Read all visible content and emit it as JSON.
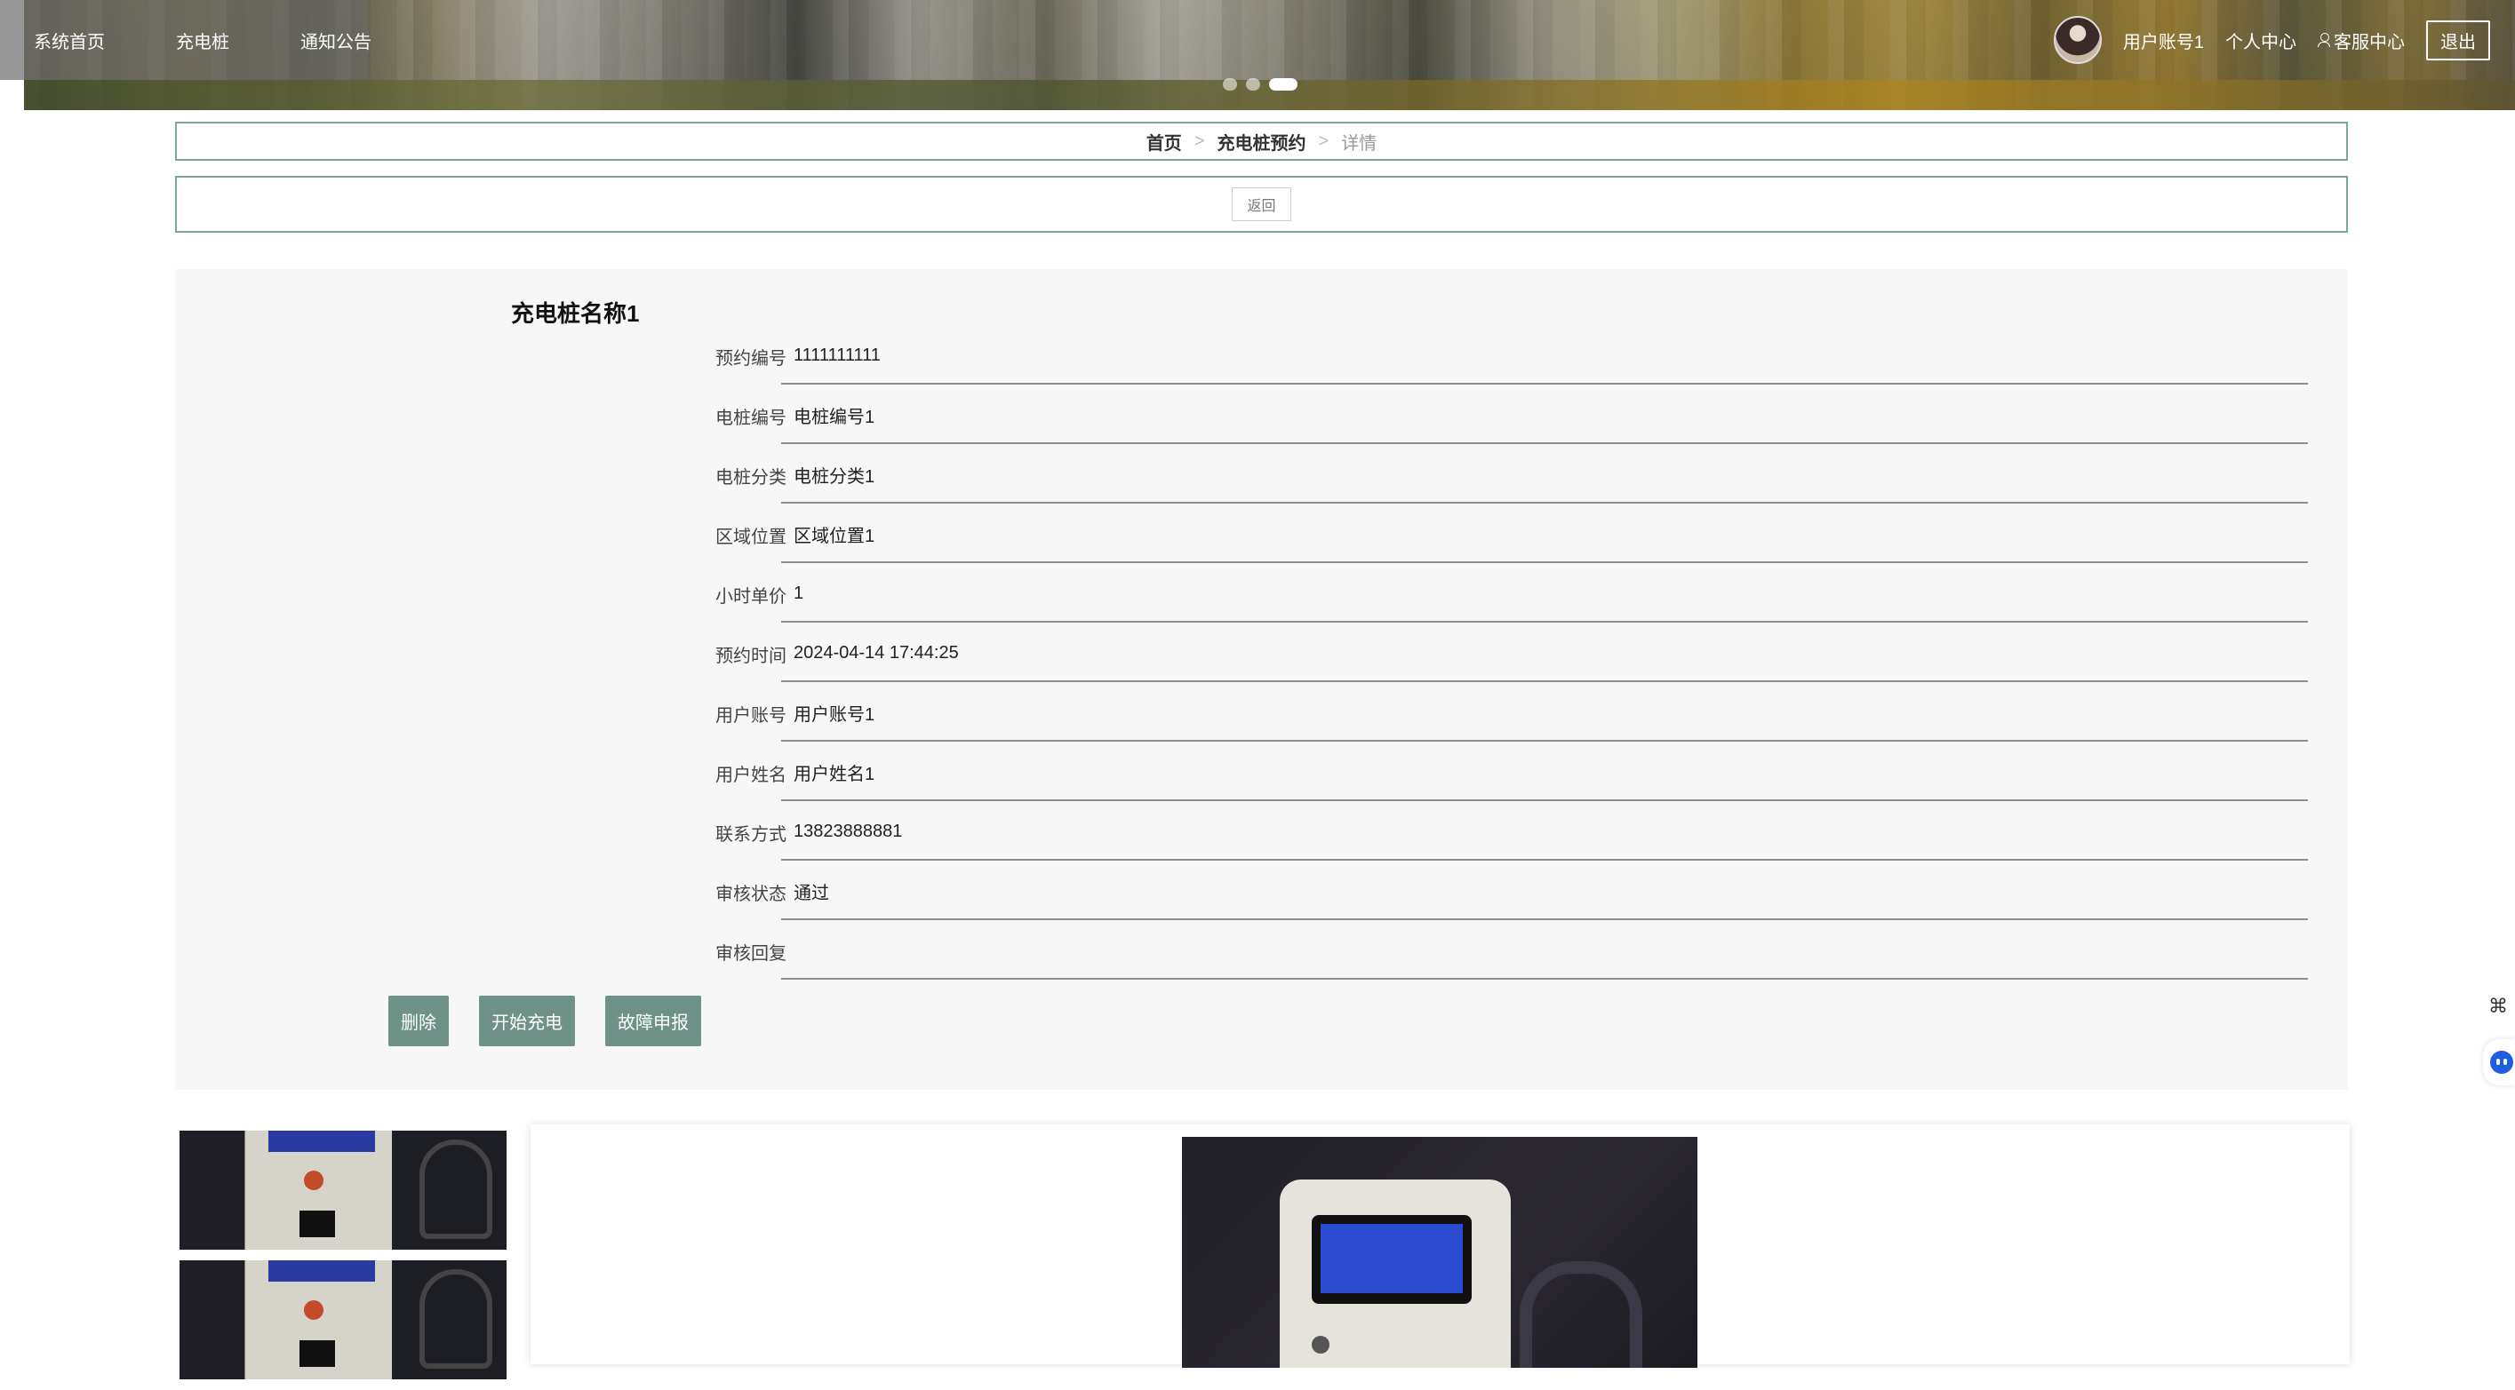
{
  "nav": {
    "items": [
      "系统首页",
      "充电桩",
      "通知公告"
    ],
    "user": "用户账号1",
    "personal": "个人中心",
    "service": "客服中心",
    "logout": "退出"
  },
  "carousel": {
    "count": 3,
    "active": 3
  },
  "breadcrumb": {
    "home": "首页",
    "section": "充电桩预约",
    "current": "详情",
    "separator": ">"
  },
  "back_label": "返回",
  "detail": {
    "title": "充电桩名称1",
    "fields": [
      {
        "label": "预约编号",
        "value": "1111111111"
      },
      {
        "label": "电桩编号",
        "value": "电桩编号1"
      },
      {
        "label": "电桩分类",
        "value": "电桩分类1"
      },
      {
        "label": "区域位置",
        "value": "区域位置1"
      },
      {
        "label": "小时单价",
        "value": "1"
      },
      {
        "label": "预约时间",
        "value": "2024-04-14 17:44:25"
      },
      {
        "label": "用户账号",
        "value": "用户账号1"
      },
      {
        "label": "用户姓名",
        "value": "用户姓名1"
      },
      {
        "label": "联系方式",
        "value": "13823888881"
      },
      {
        "label": "审核状态",
        "value": "通过"
      },
      {
        "label": "审核回复",
        "value": ""
      }
    ],
    "actions": [
      "删除",
      "开始充电",
      "故障申报"
    ]
  },
  "floating": {
    "top_icon": "⌘",
    "bot_icon": "assistant-robot-icon"
  },
  "colors": {
    "accent": "#6e9188",
    "border": "#7aa8a0"
  }
}
